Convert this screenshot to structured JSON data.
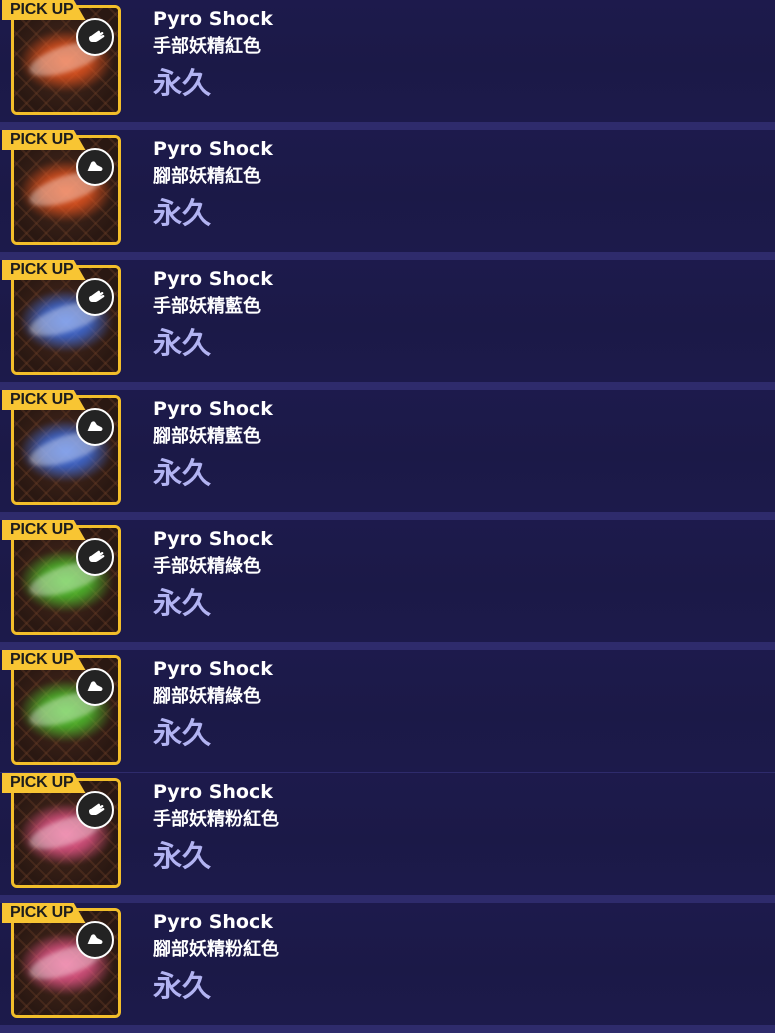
{
  "accent_colors": {
    "frame": "#f2be2a",
    "pickup_tag": "#f8c533",
    "duration_text": "#b2b3f2",
    "row_background": "#1d1a4c",
    "divider": "#2e2b6c"
  },
  "items": [
    {
      "pickup_label": "PICK UP",
      "name": "Pyro Shock",
      "subtitle": "手部妖精紅色",
      "duration": "永久",
      "icon": "hand-icon",
      "flare_color": "#ff5a1f"
    },
    {
      "pickup_label": "PICK UP",
      "name": "Pyro Shock",
      "subtitle": "腳部妖精紅色",
      "duration": "永久",
      "icon": "foot-icon",
      "flare_color": "#ff5a1f"
    },
    {
      "pickup_label": "PICK UP",
      "name": "Pyro Shock",
      "subtitle": "手部妖精藍色",
      "duration": "永久",
      "icon": "hand-icon",
      "flare_color": "#3c78ff"
    },
    {
      "pickup_label": "PICK UP",
      "name": "Pyro Shock",
      "subtitle": "腳部妖精藍色",
      "duration": "永久",
      "icon": "foot-icon",
      "flare_color": "#3c78ff"
    },
    {
      "pickup_label": "PICK UP",
      "name": "Pyro Shock",
      "subtitle": "手部妖精綠色",
      "duration": "永久",
      "icon": "hand-icon",
      "flare_color": "#4fdc2f"
    },
    {
      "pickup_label": "PICK UP",
      "name": "Pyro Shock",
      "subtitle": "腳部妖精綠色",
      "duration": "永久",
      "icon": "foot-icon",
      "flare_color": "#4fdc2f"
    },
    {
      "pickup_label": "PICK UP",
      "name": "Pyro Shock",
      "subtitle": "手部妖精粉紅色",
      "duration": "永久",
      "icon": "hand-icon",
      "flare_color": "#ff5c9a"
    },
    {
      "pickup_label": "PICK UP",
      "name": "Pyro Shock",
      "subtitle": "腳部妖精粉紅色",
      "duration": "永久",
      "icon": "foot-icon",
      "flare_color": "#ff5c9a"
    }
  ]
}
